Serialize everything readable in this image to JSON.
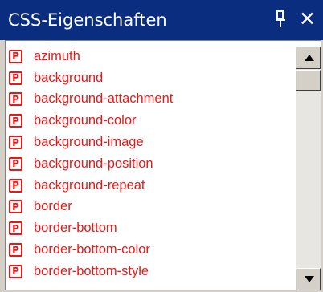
{
  "window": {
    "title": "CSS-Eigenschaften",
    "close_label": "✕"
  },
  "properties": [
    {
      "label": "azimuth"
    },
    {
      "label": "background"
    },
    {
      "label": "background-attachment"
    },
    {
      "label": "background-color"
    },
    {
      "label": "background-image"
    },
    {
      "label": "background-position"
    },
    {
      "label": "background-repeat"
    },
    {
      "label": "border"
    },
    {
      "label": "border-bottom"
    },
    {
      "label": "border-bottom-color"
    },
    {
      "label": "border-bottom-style"
    }
  ],
  "icon": {
    "letter": "P",
    "name": "property-icon",
    "color": "#e81818"
  },
  "colors": {
    "title_bg": "#0b2d80",
    "item_text": "#e81818"
  }
}
